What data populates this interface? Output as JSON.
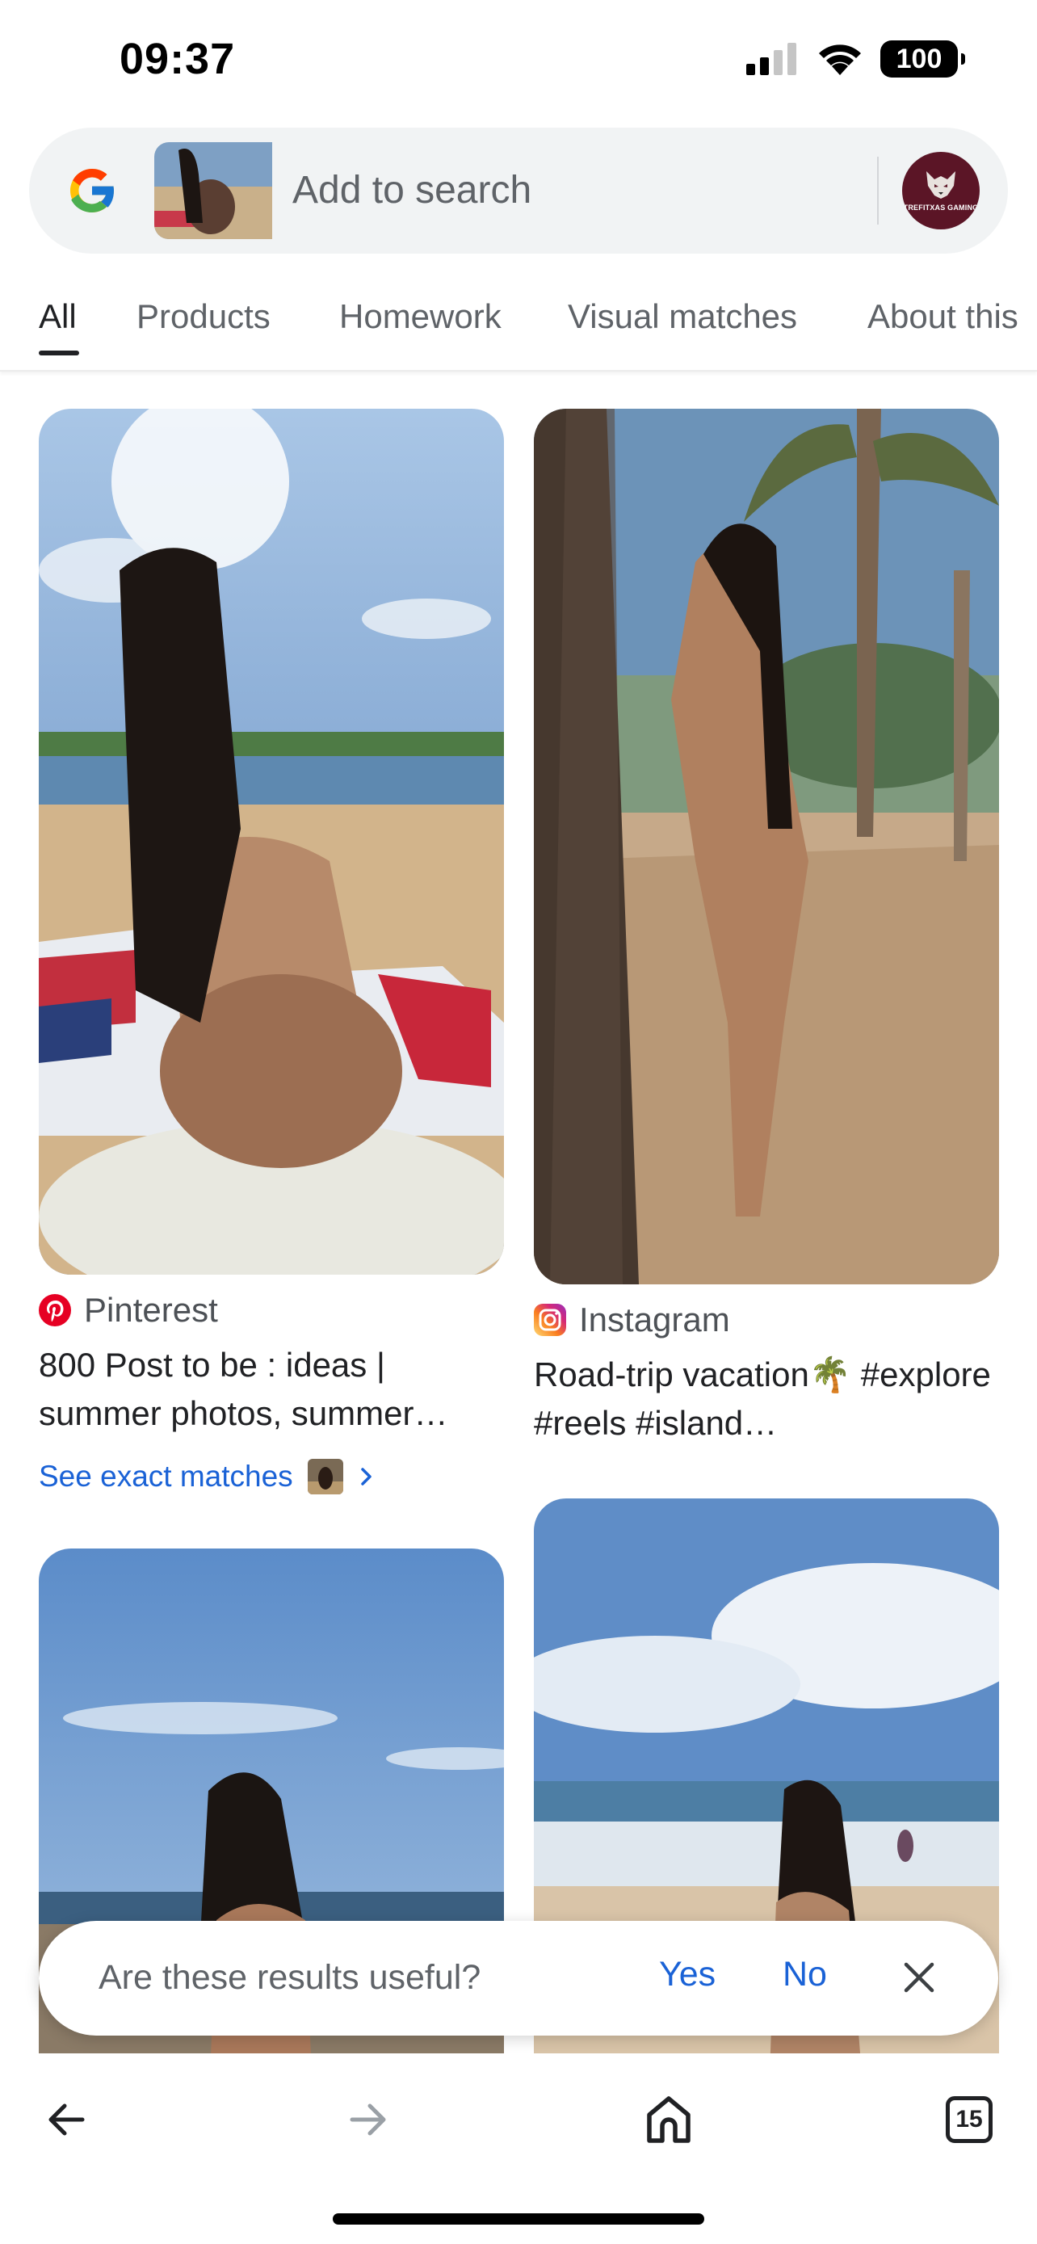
{
  "status_bar": {
    "time": "09:37",
    "battery": "100",
    "icons": [
      "cellular-signal-icon",
      "wifi-icon",
      "battery-icon"
    ]
  },
  "search": {
    "placeholder": "Add to search",
    "logo": "google-g-icon",
    "avatar_text": "TREFITXAS GAMING"
  },
  "tabs": [
    {
      "label": "All",
      "active": true
    },
    {
      "label": "Products"
    },
    {
      "label": "Homework"
    },
    {
      "label": "Visual matches"
    },
    {
      "label": "About this"
    }
  ],
  "results": [
    {
      "source": "Pinterest",
      "source_icon": "pinterest-icon",
      "title": "800 Post to be : ideas | summer photos, summer…",
      "exact_matches": "See exact matches"
    },
    {
      "source": "Instagram",
      "source_icon": "instagram-icon",
      "title": "Road-trip vacation🌴 #explore #reels #island…"
    },
    {
      "source": "",
      "title": ""
    },
    {
      "source": "",
      "title": ""
    }
  ],
  "feedback": {
    "question": "Are these results useful?",
    "yes": "Yes",
    "no": "No"
  },
  "toolbar": {
    "tab_count": "15",
    "icons": [
      "back-arrow-icon",
      "forward-arrow-icon",
      "home-icon",
      "tab-switcher-icon"
    ]
  },
  "colors": {
    "link_blue": "#1a62d6",
    "search_bg": "#f1f3f4",
    "text_primary": "#202124",
    "text_secondary": "#5f6368",
    "pinterest_red": "#e60023",
    "avatar_bg": "#5b1526"
  }
}
